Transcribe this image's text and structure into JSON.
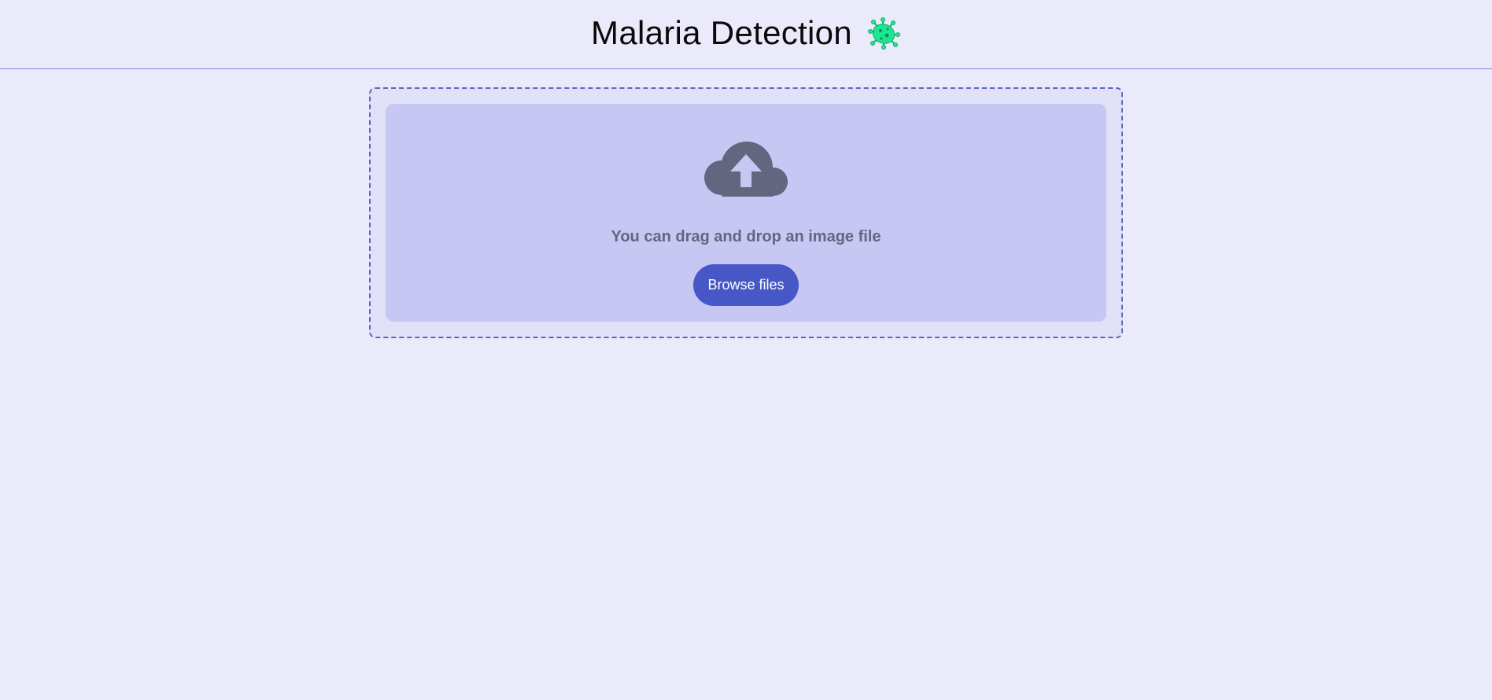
{
  "header": {
    "title": "Malaria Detection",
    "icon": "microbe-icon"
  },
  "uploader": {
    "icon": "cloud-upload-icon",
    "instruction": "You can drag and drop an image file",
    "browse_label": "Browse files"
  },
  "colors": {
    "page_background": "#EAEAFB",
    "header_divider": "#7B86DC",
    "dropzone_border": "#5A66C8",
    "dropzone_fill": "#C6C7F3",
    "icon_gray": "#63667F",
    "button_blue": "#4757C6",
    "microbe_green": "#1EE690"
  }
}
